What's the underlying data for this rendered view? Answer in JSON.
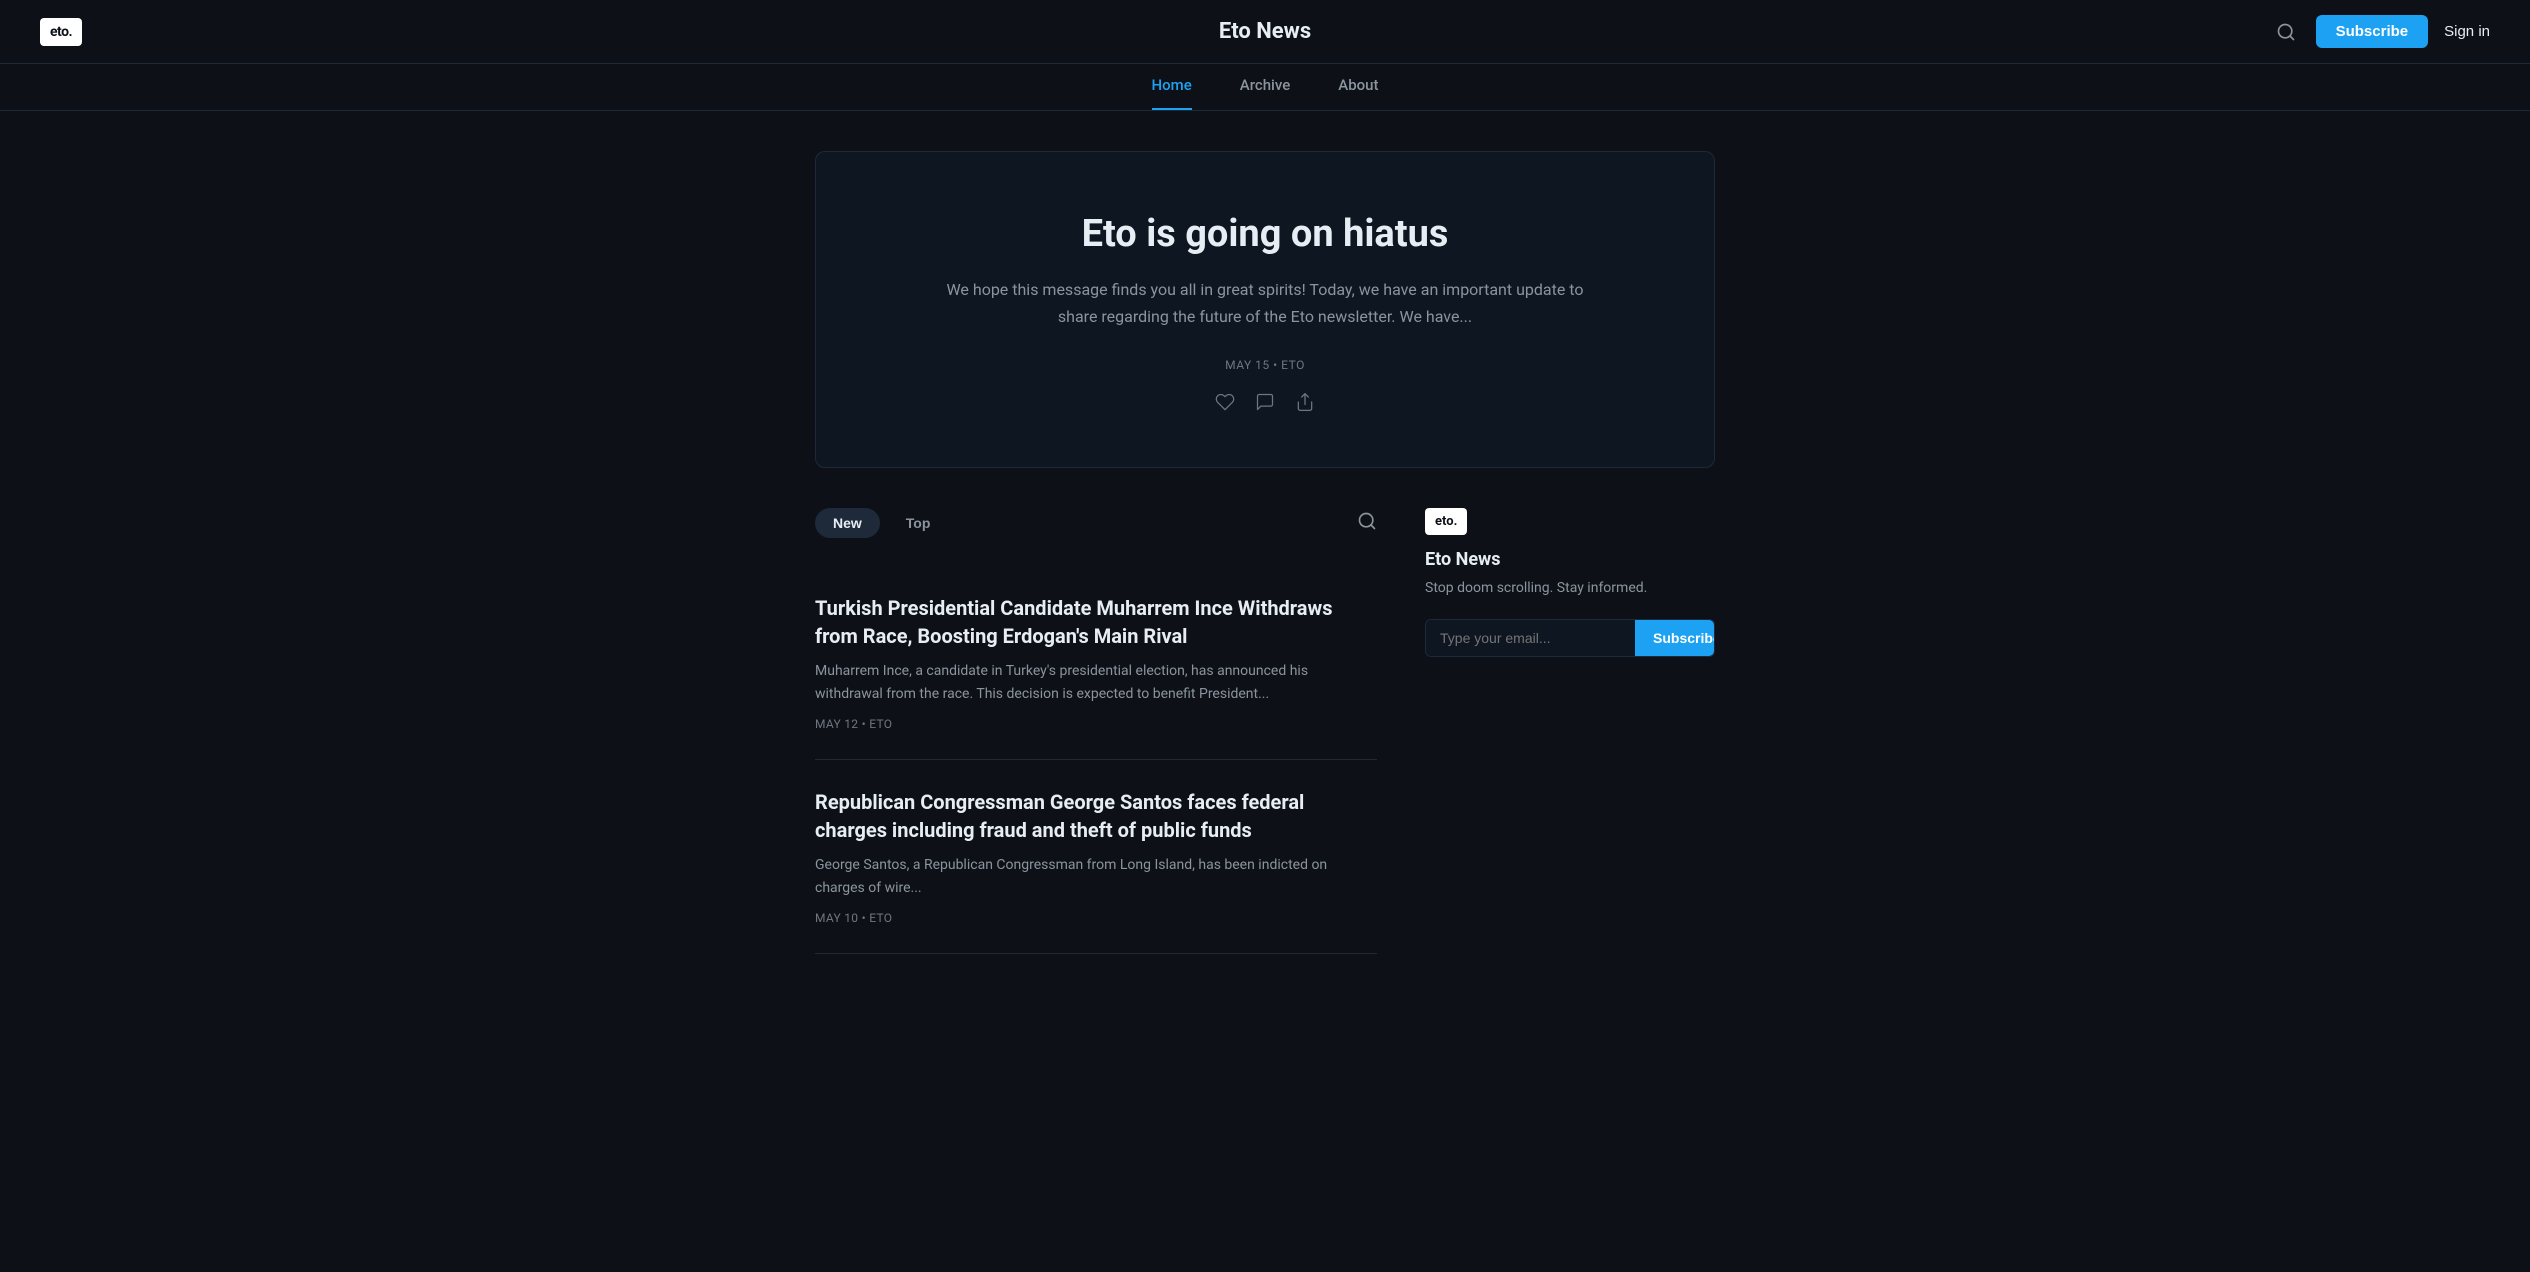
{
  "header": {
    "logo_text": "eto.",
    "title": "Eto News",
    "subscribe_label": "Subscribe",
    "signin_label": "Sign in"
  },
  "nav": {
    "items": [
      {
        "id": "home",
        "label": "Home",
        "active": true
      },
      {
        "id": "archive",
        "label": "Archive",
        "active": false
      },
      {
        "id": "about",
        "label": "About",
        "active": false
      }
    ]
  },
  "hero": {
    "title": "Eto is going on hiatus",
    "description": "We hope this message finds you all in great spirits! Today, we have an important update to share regarding the future of the Eto newsletter. We have...",
    "meta": "MAY 15 • ETO"
  },
  "posts": {
    "tab_new": "New",
    "tab_top": "Top",
    "items": [
      {
        "title": "Turkish Presidential Candidate Muharrem Ince Withdraws from Race, Boosting Erdogan's Main Rival",
        "excerpt": "Muharrem Ince, a candidate in Turkey's presidential election, has announced his withdrawal from the race. This decision is expected to benefit President...",
        "meta": "MAY 12 • ETO"
      },
      {
        "title": "Republican Congressman George Santos faces federal charges including fraud and theft of public funds",
        "excerpt": "George Santos, a Republican Congressman from Long Island, has been indicted on charges of wire...",
        "meta": "MAY 10 • ETO"
      }
    ]
  },
  "sidebar": {
    "logo_text": "eto.",
    "name": "Eto News",
    "tagline": "Stop doom scrolling. Stay informed.",
    "email_placeholder": "Type your email...",
    "subscribe_label": "Subscribe"
  }
}
